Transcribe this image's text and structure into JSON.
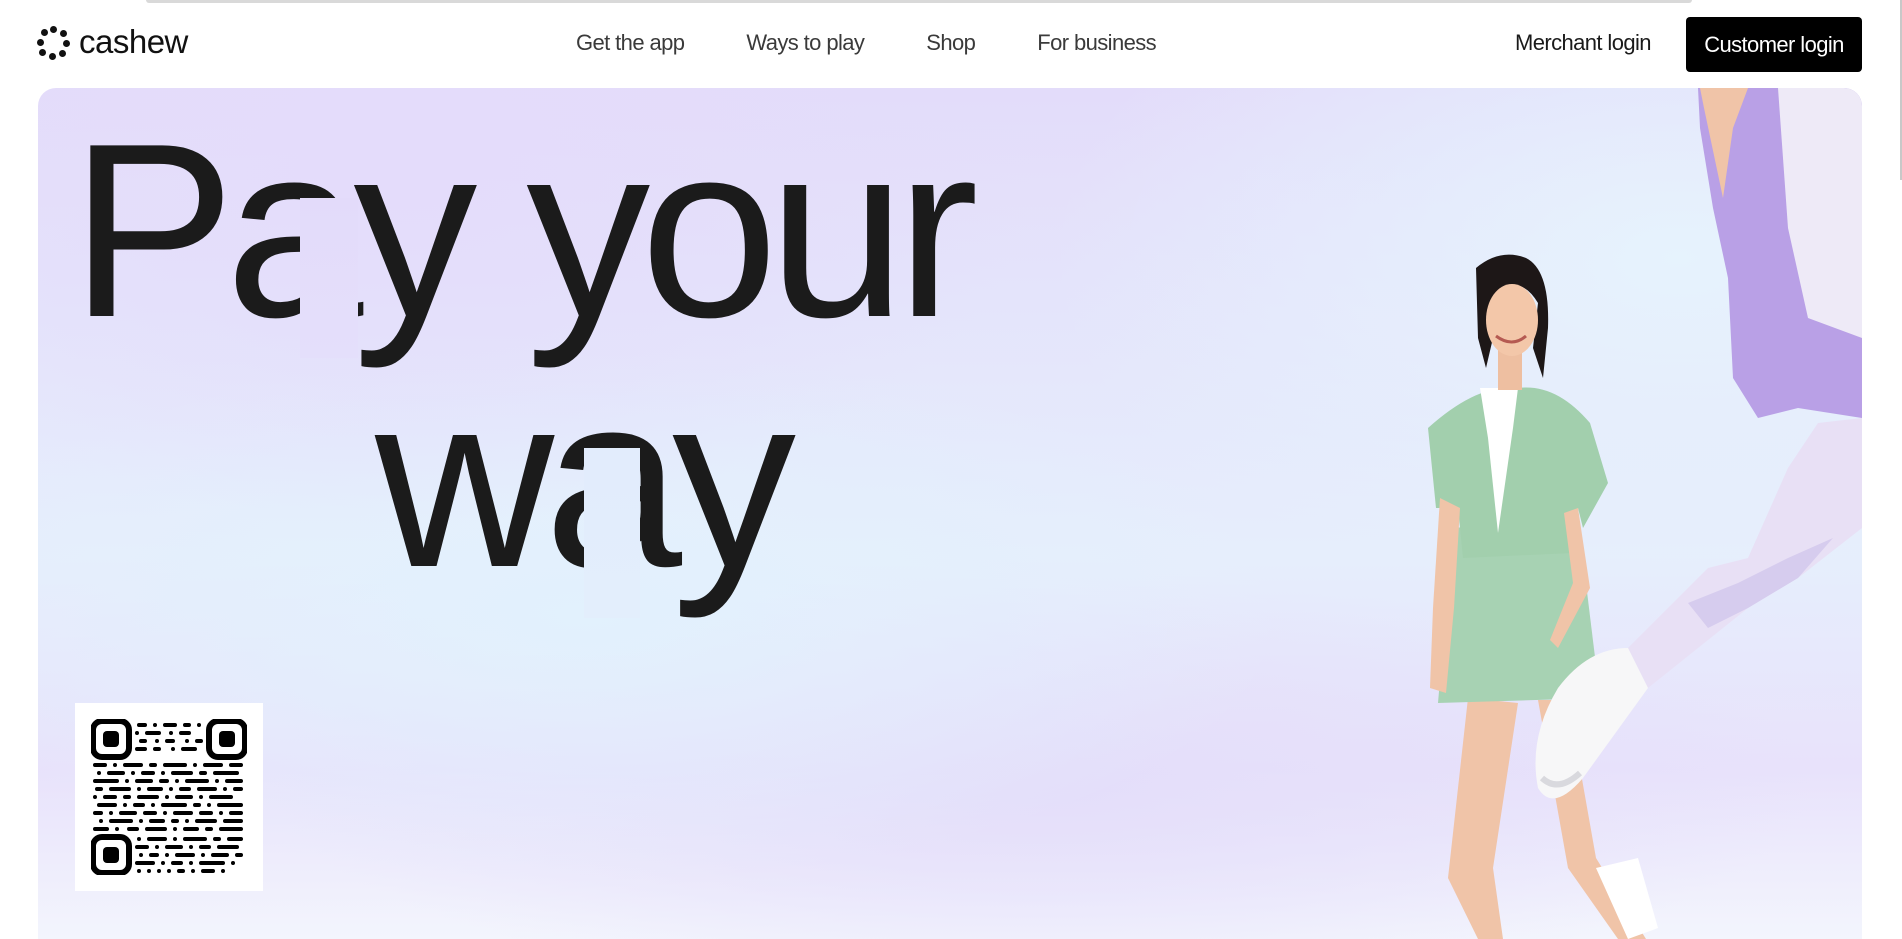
{
  "brand": {
    "name": "cashew"
  },
  "nav": {
    "items": [
      "Get the app",
      "Ways to play",
      "Shop",
      "For business"
    ]
  },
  "auth": {
    "merchant_login": "Merchant login",
    "customer_login": "Customer login"
  },
  "hero": {
    "headline_line1": "Pay your",
    "headline_line2": "way"
  },
  "colors": {
    "accent_button": "#000000",
    "hero_lavender": "#e3dcfa",
    "hero_sky": "#e6f3fd"
  },
  "icons": {
    "logo": "cashew-dots-logo-icon",
    "qr": "qr-code-icon"
  }
}
